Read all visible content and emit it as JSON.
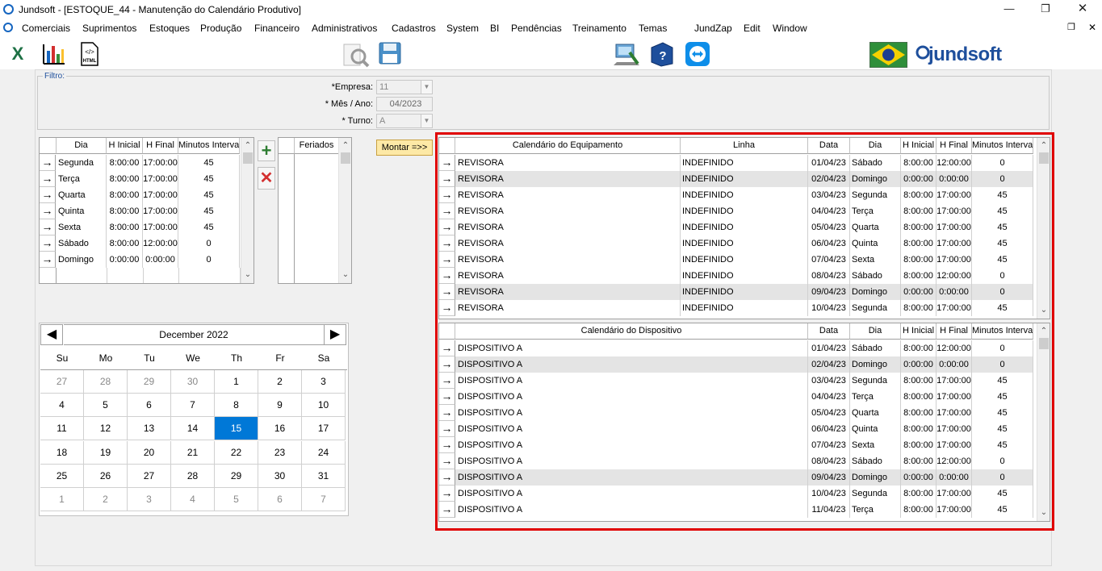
{
  "window": {
    "title": "Jundsoft - [ESTOQUE_44 - Manutenção do Calendário Produtivo]"
  },
  "menu": [
    "Comerciais",
    "Suprimentos",
    "Estoques",
    "Produção",
    "Financeiro",
    "Administrativos",
    "Cadastros",
    "System",
    "BI",
    "Pendências",
    "Treinamento",
    "Temas",
    "JundZap",
    "Edit",
    "Window"
  ],
  "toolbar": {
    "brand": "jundsoft"
  },
  "filter": {
    "legend": "Filtro:",
    "empresa_label": "*Empresa:",
    "empresa_value": "11",
    "mes_label": "* Mês / Ano:",
    "mes_value": "04/2023",
    "turno_label": "* Turno:",
    "turno_value": "A"
  },
  "schedule": {
    "headers": [
      "Dia",
      "H Inicial",
      "H Final",
      "Minutos Intervalo"
    ],
    "rows": [
      [
        "Segunda",
        "8:00:00",
        "17:00:00",
        "45"
      ],
      [
        "Terça",
        "8:00:00",
        "17:00:00",
        "45"
      ],
      [
        "Quarta",
        "8:00:00",
        "17:00:00",
        "45"
      ],
      [
        "Quinta",
        "8:00:00",
        "17:00:00",
        "45"
      ],
      [
        "Sexta",
        "8:00:00",
        "17:00:00",
        "45"
      ],
      [
        "Sábado",
        "8:00:00",
        "12:00:00",
        "0"
      ],
      [
        "Domingo",
        "0:00:00",
        "0:00:00",
        "0"
      ]
    ]
  },
  "holidays": {
    "header": "Feriados"
  },
  "montar_label": "Montar =>>",
  "calendar": {
    "month": "December 2022",
    "dow": [
      "Su",
      "Mo",
      "Tu",
      "We",
      "Th",
      "Fr",
      "Sa"
    ],
    "weeks": [
      [
        "27",
        "28",
        "29",
        "30",
        "1",
        "2",
        "3"
      ],
      [
        "4",
        "5",
        "6",
        "7",
        "8",
        "9",
        "10"
      ],
      [
        "11",
        "12",
        "13",
        "14",
        "15",
        "16",
        "17"
      ],
      [
        "18",
        "19",
        "20",
        "21",
        "22",
        "23",
        "24"
      ],
      [
        "25",
        "26",
        "27",
        "28",
        "29",
        "30",
        "31"
      ],
      [
        "1",
        "2",
        "3",
        "4",
        "5",
        "6",
        "7"
      ]
    ],
    "selected": "15"
  },
  "equip": {
    "headers": [
      "Calendário do Equipamento",
      "Linha",
      "Data",
      "Dia",
      "H Inicial",
      "H Final",
      "Minutos Intervalo"
    ],
    "rows": [
      [
        "REVISORA",
        "INDEFINIDO",
        "01/04/23",
        "Sábado",
        "8:00:00",
        "12:00:00",
        "0"
      ],
      [
        "REVISORA",
        "INDEFINIDO",
        "02/04/23",
        "Domingo",
        "0:00:00",
        "0:00:00",
        "0"
      ],
      [
        "REVISORA",
        "INDEFINIDO",
        "03/04/23",
        "Segunda",
        "8:00:00",
        "17:00:00",
        "45"
      ],
      [
        "REVISORA",
        "INDEFINIDO",
        "04/04/23",
        "Terça",
        "8:00:00",
        "17:00:00",
        "45"
      ],
      [
        "REVISORA",
        "INDEFINIDO",
        "05/04/23",
        "Quarta",
        "8:00:00",
        "17:00:00",
        "45"
      ],
      [
        "REVISORA",
        "INDEFINIDO",
        "06/04/23",
        "Quinta",
        "8:00:00",
        "17:00:00",
        "45"
      ],
      [
        "REVISORA",
        "INDEFINIDO",
        "07/04/23",
        "Sexta",
        "8:00:00",
        "17:00:00",
        "45"
      ],
      [
        "REVISORA",
        "INDEFINIDO",
        "08/04/23",
        "Sábado",
        "8:00:00",
        "12:00:00",
        "0"
      ],
      [
        "REVISORA",
        "INDEFINIDO",
        "09/04/23",
        "Domingo",
        "0:00:00",
        "0:00:00",
        "0"
      ],
      [
        "REVISORA",
        "INDEFINIDO",
        "10/04/23",
        "Segunda",
        "8:00:00",
        "17:00:00",
        "45"
      ]
    ]
  },
  "device": {
    "headers": [
      "Calendário do Dispositivo",
      "Data",
      "Dia",
      "H Inicial",
      "H Final",
      "Minutos Intervalo"
    ],
    "rows": [
      [
        "DISPOSITIVO A",
        "01/04/23",
        "Sábado",
        "8:00:00",
        "12:00:00",
        "0"
      ],
      [
        "DISPOSITIVO A",
        "02/04/23",
        "Domingo",
        "0:00:00",
        "0:00:00",
        "0"
      ],
      [
        "DISPOSITIVO A",
        "03/04/23",
        "Segunda",
        "8:00:00",
        "17:00:00",
        "45"
      ],
      [
        "DISPOSITIVO A",
        "04/04/23",
        "Terça",
        "8:00:00",
        "17:00:00",
        "45"
      ],
      [
        "DISPOSITIVO A",
        "05/04/23",
        "Quarta",
        "8:00:00",
        "17:00:00",
        "45"
      ],
      [
        "DISPOSITIVO A",
        "06/04/23",
        "Quinta",
        "8:00:00",
        "17:00:00",
        "45"
      ],
      [
        "DISPOSITIVO A",
        "07/04/23",
        "Sexta",
        "8:00:00",
        "17:00:00",
        "45"
      ],
      [
        "DISPOSITIVO A",
        "08/04/23",
        "Sábado",
        "8:00:00",
        "12:00:00",
        "0"
      ],
      [
        "DISPOSITIVO A",
        "09/04/23",
        "Domingo",
        "0:00:00",
        "0:00:00",
        "0"
      ],
      [
        "DISPOSITIVO A",
        "10/04/23",
        "Segunda",
        "8:00:00",
        "17:00:00",
        "45"
      ],
      [
        "DISPOSITIVO A",
        "11/04/23",
        "Terça",
        "8:00:00",
        "17:00:00",
        "45"
      ]
    ]
  },
  "colors": {
    "highlight_box": "#e00000",
    "selection": "#0078d7"
  }
}
